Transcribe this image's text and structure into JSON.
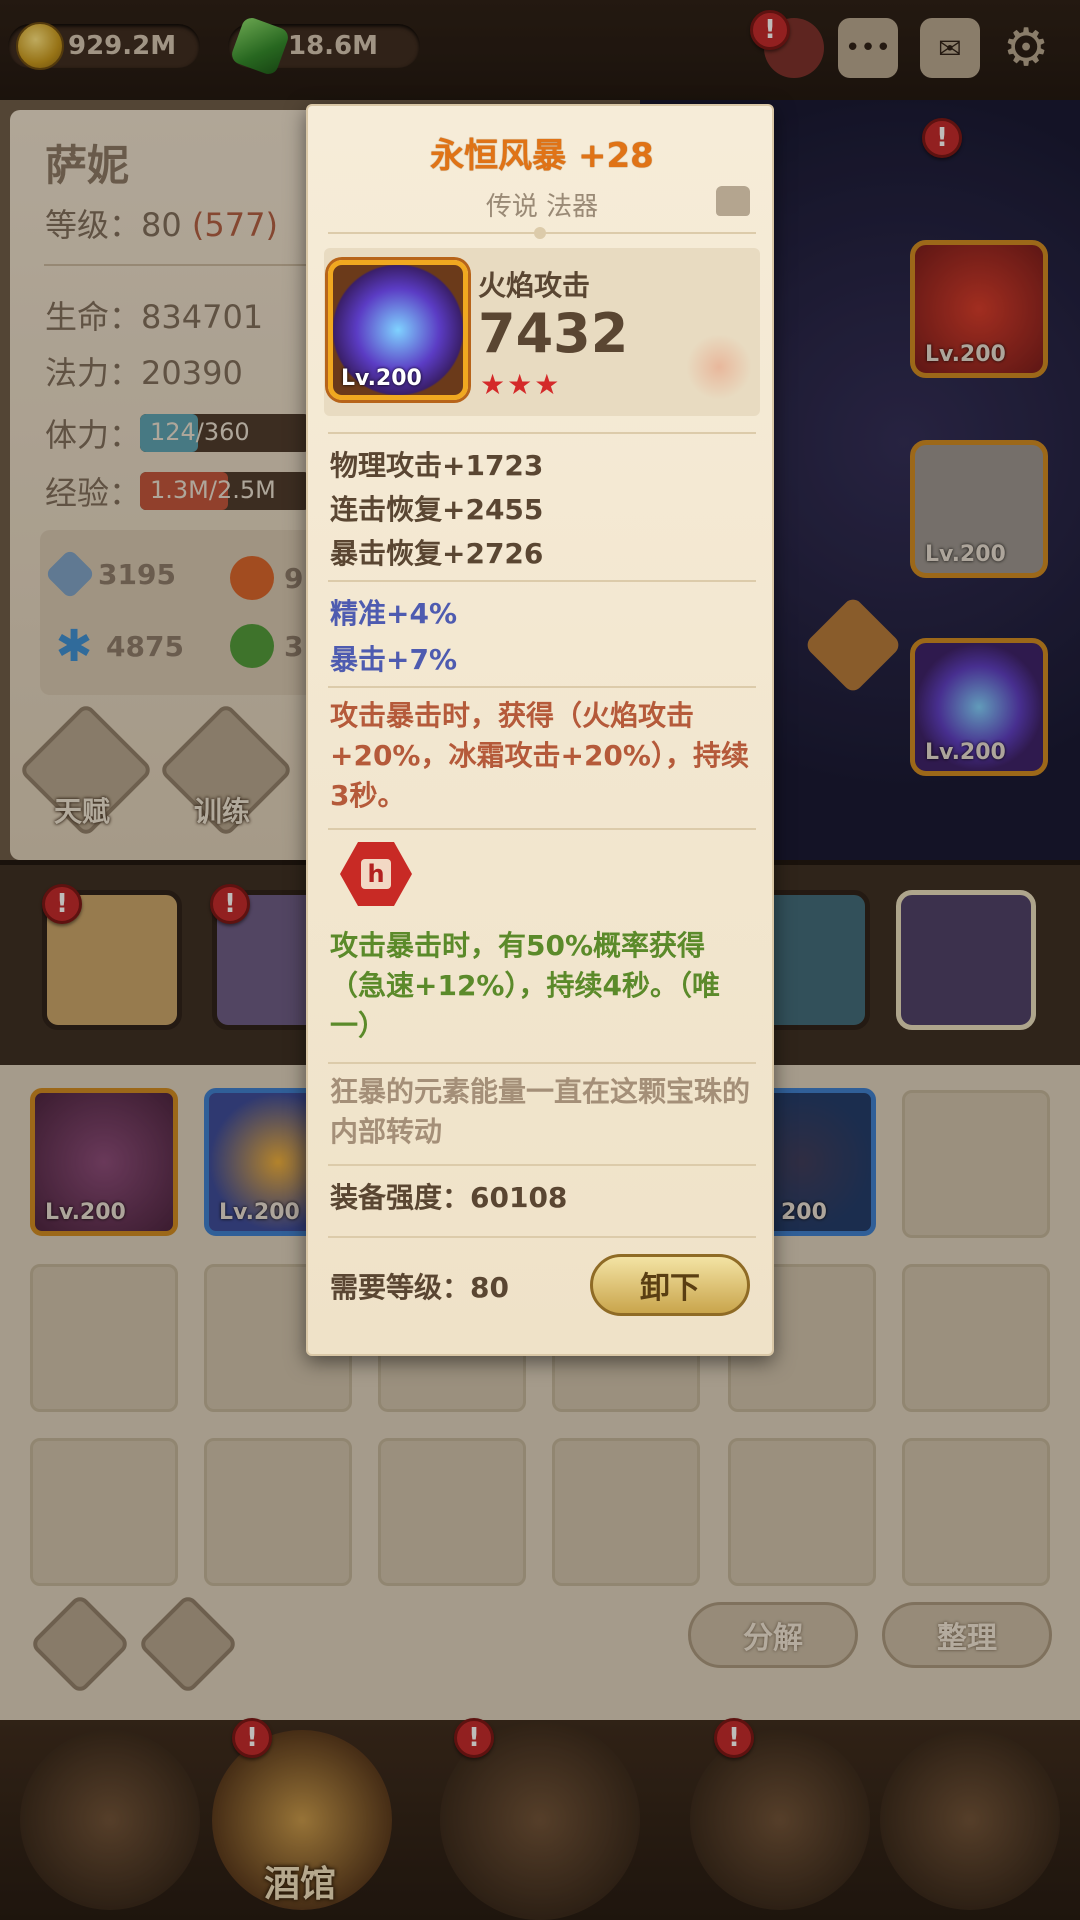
{
  "resources": {
    "gold": "929.2M",
    "gems": "18.6M"
  },
  "top_icons": [
    "pouch-icon",
    "chat-icon",
    "mail-icon",
    "gear-icon"
  ],
  "hero": {
    "name": "萨妮",
    "level_label": "等级：80",
    "level_extra": "(577)",
    "hp": "生命：834701",
    "mp": "法力：20390",
    "stamina_label": "体力：",
    "stamina_value": "124/360",
    "stamina_fill": 0.344,
    "exp_label": "经验：",
    "exp_value": "1.3M/2.5M",
    "exp_fill": 0.52,
    "attrs": [
      {
        "icon": "sword-icon",
        "value": "3195"
      },
      {
        "icon": "fire-icon",
        "value": "9"
      },
      {
        "icon": "frost-icon",
        "value": "4875"
      },
      {
        "icon": "leaf-icon",
        "value": "3"
      }
    ],
    "talent_label": "天赋",
    "train_label": "训练"
  },
  "equip_levels": [
    "Lv.200",
    "Lv.200",
    "Lv.200"
  ],
  "inventory": {
    "item_levels": [
      "Lv.200",
      "Lv.200",
      "200"
    ],
    "decompose_label": "分解",
    "arrange_label": "整理"
  },
  "nav": {
    "tavern_label": "酒馆"
  },
  "tooltip": {
    "title": "永恒风暴 +28",
    "subtitle": "传说 法器",
    "item_level": "Lv.200",
    "stat_name": "火焰攻击",
    "stat_value": "7432",
    "stars": "★★★",
    "bonuses": [
      "物理攻击+1723",
      "连击恢复+2455",
      "暴击恢复+2726"
    ],
    "percent_bonuses": [
      "精准+4%",
      "暴击+7%"
    ],
    "effect_text": "攻击暴击时，获得（火焰攻击+20%，冰霜攻击+20%），持续3秒。",
    "unique_text": "攻击暴击时，有50%概率获得（急速+12%），持续4秒。（唯一）",
    "lore_text": "狂暴的元素能量一直在这颗宝珠的内部转动",
    "power": "装备强度：60108",
    "required_level": "需要等级：80",
    "unequip_label": "卸下"
  },
  "colors": {
    "title_orange": "#e07316",
    "stat_blue": "#4e5bb0",
    "effect_red": "#b55a3a",
    "unique_green": "#5b8a2a",
    "stamina_bar": "#5aa3b3",
    "exp_bar": "#c1543b"
  }
}
